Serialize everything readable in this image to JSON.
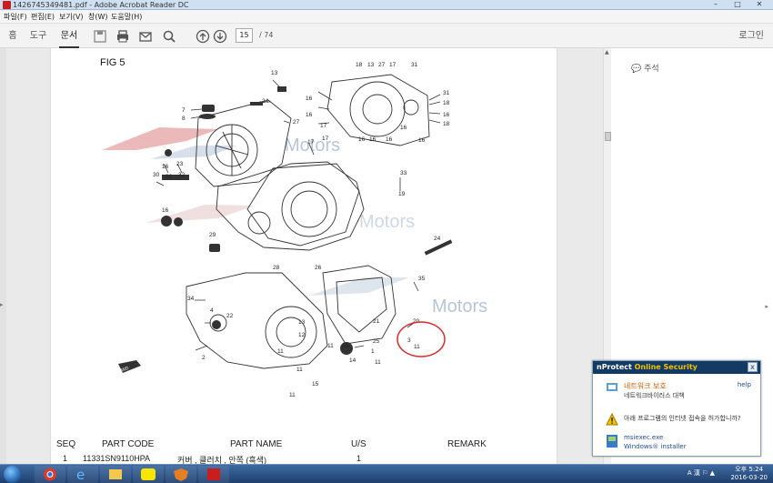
{
  "window": {
    "title": "1426745349481.pdf - Adobe Acrobat Reader DC",
    "controls": [
      "–",
      "□",
      "✕"
    ]
  },
  "menu": [
    "파일(F)",
    "편집(E)",
    "보기(V)",
    "창(W)",
    "도움말(H)"
  ],
  "toolbar": {
    "tabs": [
      "홈",
      "도구",
      "문서"
    ],
    "active_tab": "문서",
    "page_current": "15",
    "page_total": "/ 74",
    "login": "로그인",
    "icons": [
      "save-icon",
      "print-icon",
      "mail-icon",
      "search-icon",
      "page-up-icon",
      "page-down-icon"
    ]
  },
  "right_panel": {
    "comment": "주석"
  },
  "page": {
    "fig_title": "FIG 5",
    "watermark": "Motors",
    "callouts": [
      "13",
      "24",
      "7",
      "8",
      "27",
      "18",
      "13",
      "27",
      "17",
      "31",
      "31",
      "16",
      "18",
      "16",
      "16",
      "18",
      "16",
      "16",
      "16",
      "17",
      "16",
      "17",
      "16",
      "17",
      "16",
      "23",
      "30",
      "32",
      "33",
      "32",
      "16",
      "19",
      "24",
      "29",
      "28",
      "26",
      "35",
      "34",
      "22",
      "4",
      "21",
      "20",
      "11",
      "1",
      "25",
      "11",
      "12",
      "3",
      "14",
      "15",
      "25",
      "11",
      "2",
      "11",
      "11",
      "13",
      "11"
    ],
    "table_headers": [
      "SEQ",
      "PART CODE",
      "PART NAME",
      "U/S",
      "REMARK"
    ],
    "first_row": {
      "seq": "1",
      "code": "11331SN9110HPA",
      "name": "커버 , 클러치 , 안쪽 (흑색)",
      "us": "1"
    }
  },
  "popup": {
    "brand": "nProtect",
    "brand_suffix": "Online Security",
    "close": "x",
    "title": "네트워크 보호",
    "subtitle": "네트워크바이러스 대책",
    "help": "help",
    "question": "아래 프로그램의 인터넷 접속을 허가합니까?",
    "program": "msiexec.exe",
    "program_desc": "Windows® installer"
  },
  "taskbar": {
    "time": "오후 5:24",
    "date": "2016-03-20",
    "tray": "A 漢 ⚐ ▲"
  },
  "colors": {
    "accent": "#123a63",
    "warning": "#d25a00",
    "redcircle": "#d62b2b"
  }
}
